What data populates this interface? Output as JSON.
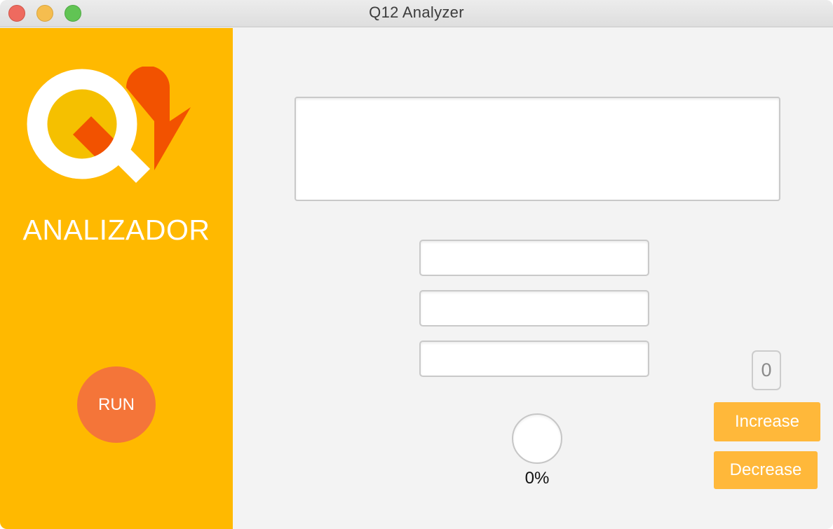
{
  "window": {
    "title": "Q12 Analyzer"
  },
  "sidebar": {
    "brand_label": "ANALIZADOR",
    "run_label": "RUN",
    "colors": {
      "background": "#ffb900",
      "run_button": "#f47539",
      "logo_ring": "#ffffff",
      "logo_center": "#f5c000",
      "logo_accent": "#f25200"
    }
  },
  "main": {
    "text_area": {
      "value": "",
      "placeholder": ""
    },
    "fields": [
      {
        "value": "",
        "placeholder": ""
      },
      {
        "value": "",
        "placeholder": ""
      },
      {
        "value": "",
        "placeholder": ""
      }
    ],
    "progress": {
      "label": "0%",
      "value": 0
    },
    "counter": {
      "value": "0"
    },
    "increase_label": "Increase",
    "decrease_label": "Decrease",
    "colors": {
      "background": "#f3f3f3",
      "action_button": "#ffb83a"
    }
  }
}
